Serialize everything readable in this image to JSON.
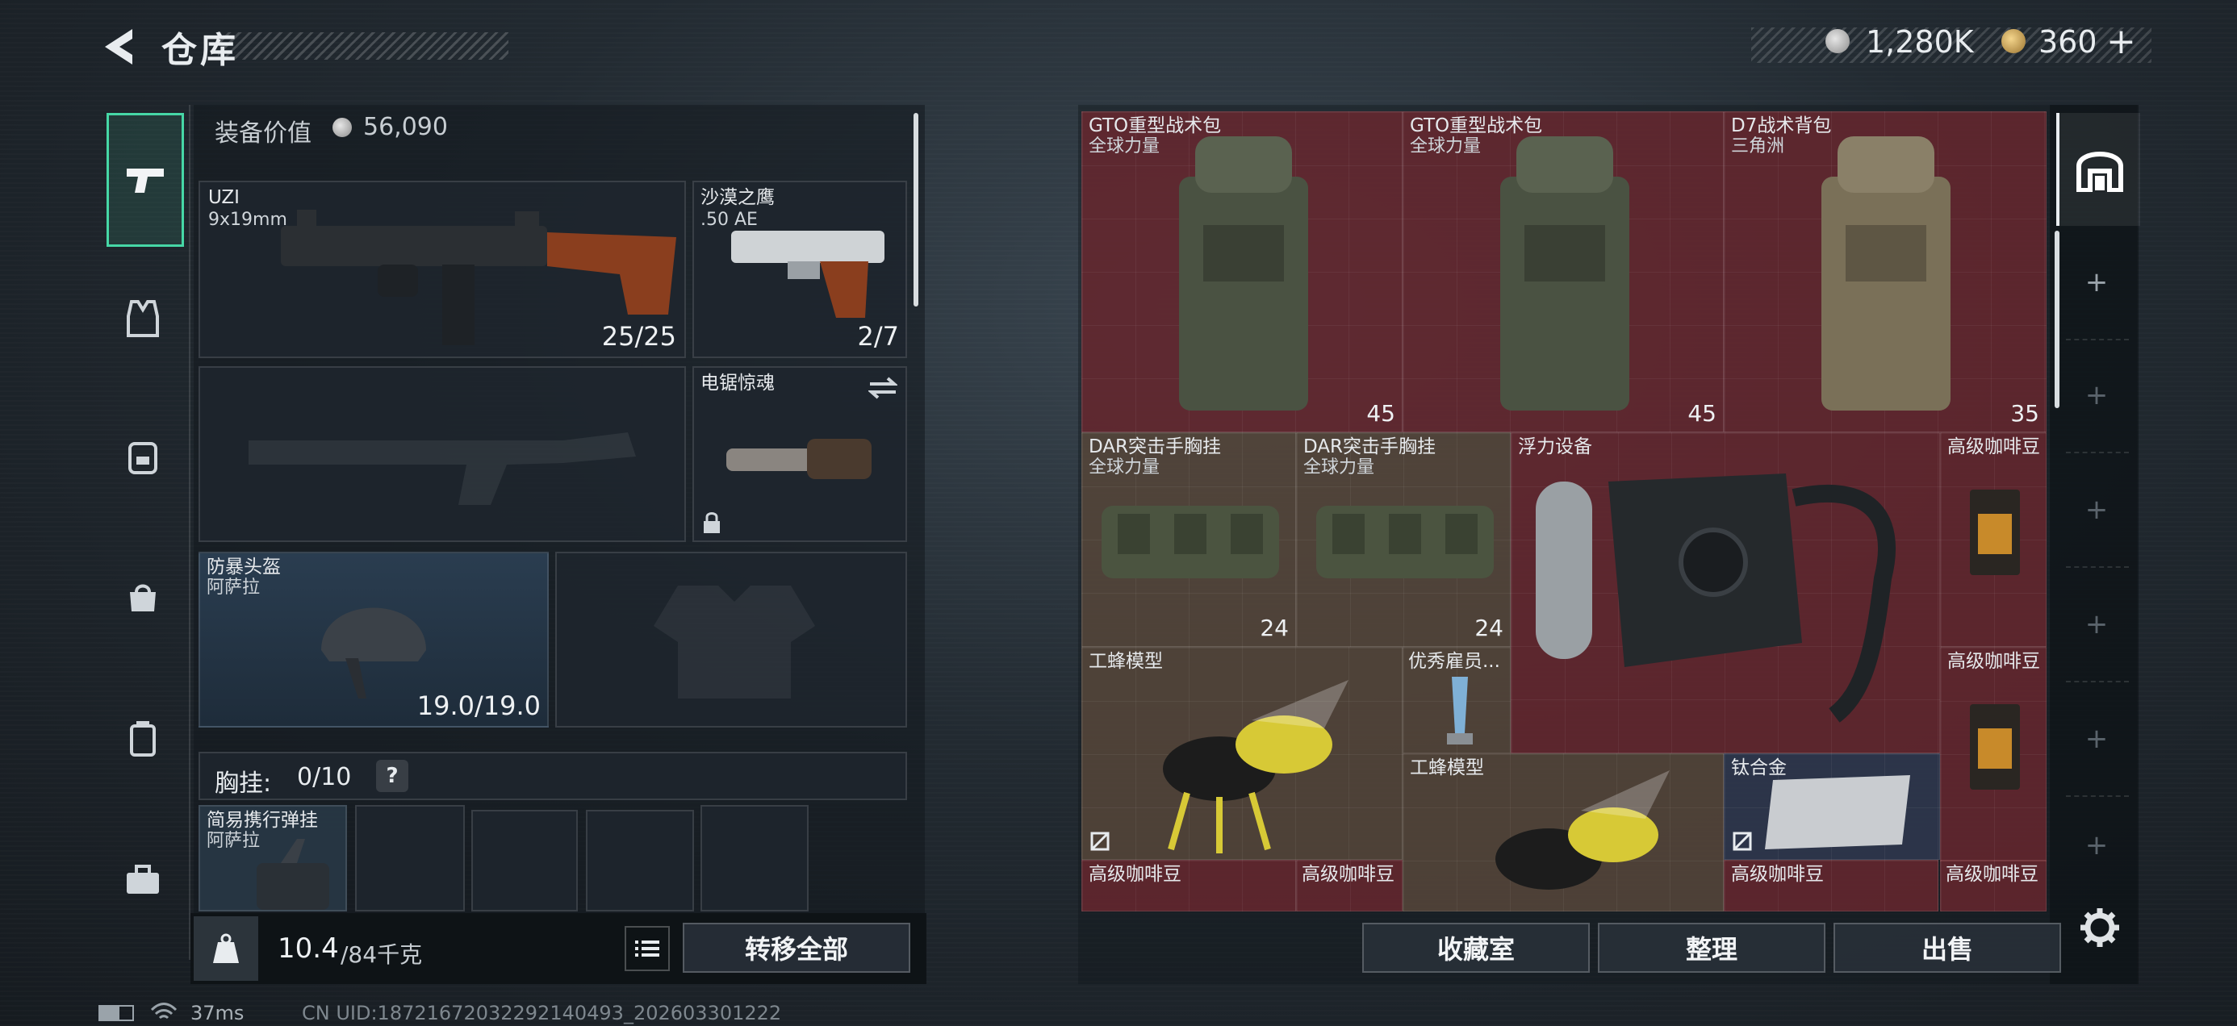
{
  "header": {
    "title": "仓库",
    "silver_amount": "1,280K",
    "gold_amount": "360",
    "gold_plus": "+"
  },
  "sidebar": {
    "items": [
      {
        "name": "weapons"
      },
      {
        "name": "vest"
      },
      {
        "name": "backpack"
      },
      {
        "name": "bag"
      },
      {
        "name": "case"
      },
      {
        "name": "toolbox"
      }
    ]
  },
  "equipment": {
    "value_label": "装备价值",
    "value": "56,090",
    "primary": {
      "name": "UZI",
      "caliber": "9x19mm",
      "ammo": "25/25"
    },
    "sidearm": {
      "name": "沙漠之鹰",
      "caliber": ".50 AE",
      "ammo": "2/7"
    },
    "melee": {
      "name": "电锯惊魂"
    },
    "helmet": {
      "name": "防暴头盔",
      "origin": "阿萨拉",
      "durability": "19.0/19.0"
    },
    "rig": {
      "label": "胸挂:",
      "count": "0/10",
      "help": "?"
    },
    "pouch": {
      "name": "简易携行弹挂",
      "origin": "阿萨拉"
    }
  },
  "footer": {
    "weight": "10.4",
    "capacity": "/84千克",
    "kg_label": "KG",
    "transfer_all": "转移全部",
    "collection": "收藏室",
    "organize": "整理",
    "sell": "出售"
  },
  "stash": {
    "items": [
      {
        "name": "GTO重型战术包",
        "origin": "全球力量",
        "count": "45"
      },
      {
        "name": "GTO重型战术包",
        "origin": "全球力量",
        "count": "45"
      },
      {
        "name": "D7战术背包",
        "origin": "三角洲",
        "count": "35"
      },
      {
        "name": "DAR突击手胸挂",
        "origin": "全球力量",
        "count": "24"
      },
      {
        "name": "DAR突击手胸挂",
        "origin": "全球力量",
        "count": "24"
      },
      {
        "name": "浮力设备"
      },
      {
        "name": "高级咖啡豆"
      },
      {
        "name": "工蜂模型"
      },
      {
        "name": "优秀雇员..."
      },
      {
        "name": "高级咖啡豆"
      },
      {
        "name": "工蜂模型"
      },
      {
        "name": "钛合金"
      },
      {
        "name": "高级咖啡豆"
      },
      {
        "name": "高级咖啡豆"
      },
      {
        "name": "高级咖啡豆"
      },
      {
        "name": "高级咖啡豆"
      }
    ]
  },
  "status_bar": {
    "ping": "37ms",
    "uid": "CN UID:18721672032292140493_202603301222"
  },
  "colors": {
    "accent": "#46d7a6",
    "stash_red": "#6e2830",
    "stash_brown": "#5c4a3c"
  }
}
